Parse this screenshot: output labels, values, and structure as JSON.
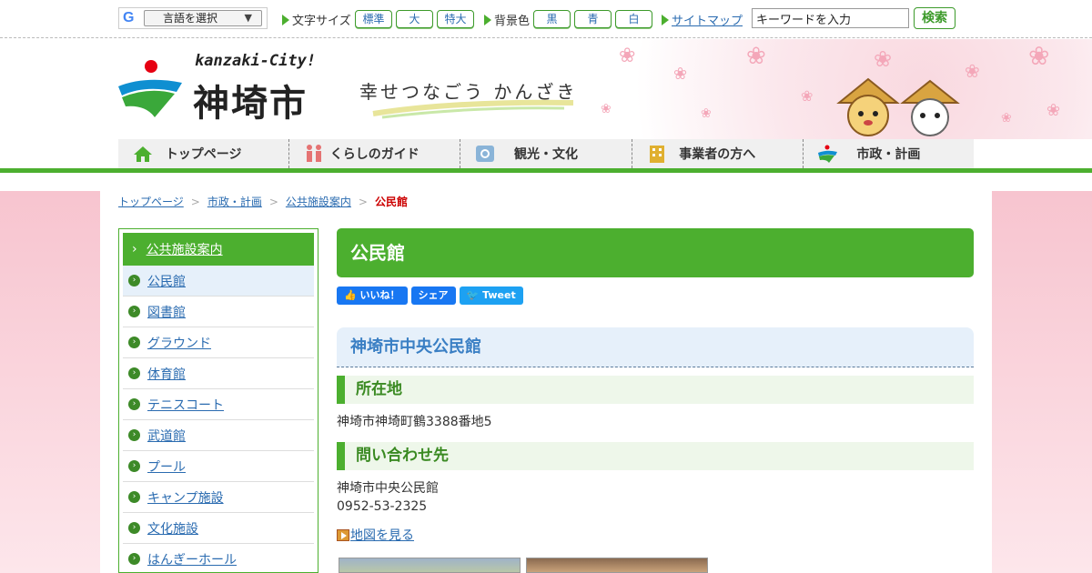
{
  "topbar": {
    "translate_label": "言語を選択",
    "fontsize_label": "文字サイズ",
    "fontsize_options": [
      "標準",
      "大",
      "特大"
    ],
    "bgcolor_label": "背景色",
    "bgcolor_options": [
      "黒",
      "青",
      "白"
    ],
    "sitemap_label": "サイトマップ",
    "search_value": "キーワードを入力",
    "search_button": "検索"
  },
  "header": {
    "logo_en": "kanzaki-City!",
    "logo_jp": "神埼市",
    "slogan": "幸せつなごう かんざき"
  },
  "nav": {
    "items": [
      "トップページ",
      "くらしのガイド",
      "観光・文化",
      "事業者の方へ",
      "市政・計画"
    ]
  },
  "breadcrumb": {
    "items": [
      "トップページ",
      "市政・計画",
      "公共施設案内"
    ],
    "current": "公民館"
  },
  "sidebar": {
    "heading": "公共施設案内",
    "items": [
      "公民館",
      "図書館",
      "グラウンド",
      "体育館",
      "テニスコート",
      "武道館",
      "プール",
      "キャンプ施設",
      "文化施設",
      "はんぎーホール"
    ]
  },
  "main": {
    "page_title": "公民館",
    "social": {
      "like": "いいね！",
      "share": "シェア",
      "tweet": "Tweet"
    },
    "facility_name": "神埼市中央公民館",
    "address_heading": "所在地",
    "address": "神埼市神埼町鶴3388番地5",
    "contact_heading": "問い合わせ先",
    "contact_name": "神埼市中央公民館",
    "contact_phone": "0952-53-2325",
    "map_link": "地図を見る"
  },
  "colors": {
    "accent": "#4caf2f",
    "link": "#2a6bb0",
    "current": "#cc0000",
    "facebook": "#1877f2",
    "twitter": "#1da1f2"
  }
}
